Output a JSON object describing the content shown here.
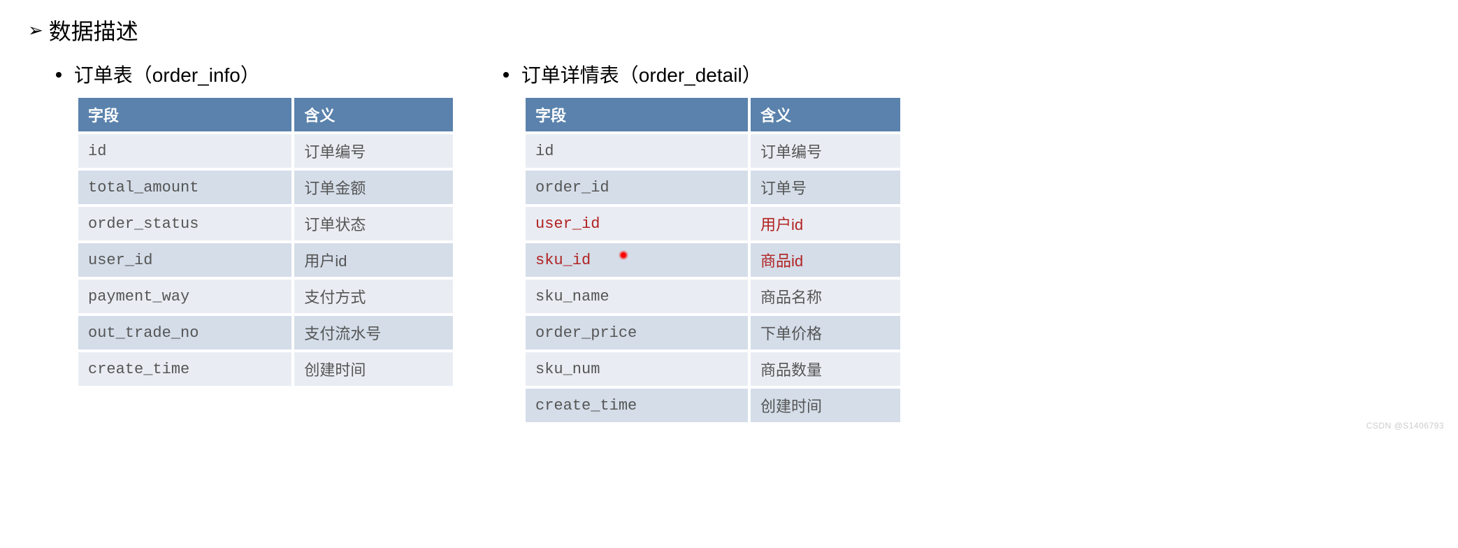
{
  "title": "数据描述",
  "left": {
    "caption_prefix": "订单表（",
    "caption_code": "order_info",
    "caption_suffix": "）",
    "headers": [
      "字段",
      "含义"
    ],
    "rows": [
      {
        "field": "id",
        "meaning": "订单编号"
      },
      {
        "field": "total_amount",
        "meaning": "订单金额"
      },
      {
        "field": "order_status",
        "meaning": "订单状态"
      },
      {
        "field": "user_id",
        "meaning": "用户id"
      },
      {
        "field": "payment_way",
        "meaning": "支付方式"
      },
      {
        "field": "out_trade_no",
        "meaning": "支付流水号"
      },
      {
        "field": "create_time",
        "meaning": "创建时间"
      }
    ]
  },
  "right": {
    "caption_prefix": "订单详情表（",
    "caption_code": "order_detail",
    "caption_suffix": "）",
    "headers": [
      "字段",
      "含义"
    ],
    "rows": [
      {
        "field": "id",
        "meaning": "订单编号"
      },
      {
        "field": "order_id",
        "meaning": "订单号"
      },
      {
        "field": "user_id",
        "meaning": "用户id",
        "highlight": true
      },
      {
        "field": "sku_id",
        "meaning": "商品id",
        "highlight": true
      },
      {
        "field": "sku_name",
        "meaning": "商品名称"
      },
      {
        "field": "order_price",
        "meaning": "下单价格"
      },
      {
        "field": "sku_num",
        "meaning": "商品数量"
      },
      {
        "field": "create_time",
        "meaning": "创建时间"
      }
    ]
  },
  "watermark": "CSDN @S1406793"
}
